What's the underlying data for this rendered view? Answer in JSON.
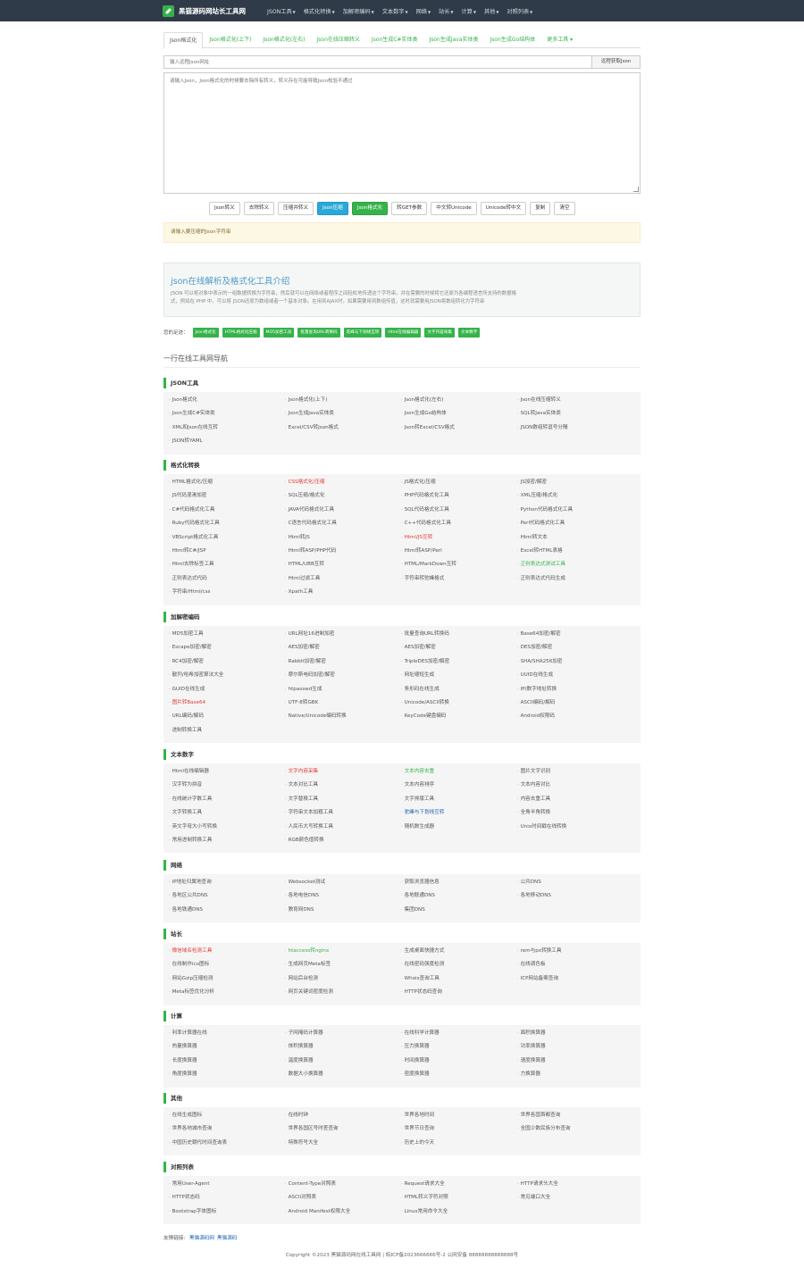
{
  "navbar": {
    "brand": "黑猫源码网站长工具网",
    "menu": [
      "JSON工具",
      "格式化转换",
      "加解密编码",
      "文本数字",
      "网络",
      "站长",
      "计算",
      "其他",
      "对照列表"
    ]
  },
  "tabs": [
    "Json格式化",
    "Json格式化(上下)",
    "Json格式化(左右)",
    "Json在线压缩转义",
    "Json生成C#实体类",
    "Json生成Java实体类",
    "Json生成Go结构体",
    "更多工具"
  ],
  "url_input": {
    "placeholder": "输入远程Json网址",
    "button": "远程获取Json"
  },
  "json_area": {
    "placeholder": "请输入Json，Json格式化的时候要去除所有转义，转义存在可能导致Json校验不通过"
  },
  "actions": [
    {
      "label": "Json转义",
      "style": "default"
    },
    {
      "label": "去除转义",
      "style": "default"
    },
    {
      "label": "压缩并转义",
      "style": "default"
    },
    {
      "label": "Json压缩",
      "style": "blue"
    },
    {
      "label": "Json格式化",
      "style": "green"
    },
    {
      "label": "转GET参数",
      "style": "default"
    },
    {
      "label": "中文转Unicode",
      "style": "default"
    },
    {
      "label": "Unicode转中文",
      "style": "default"
    },
    {
      "label": "复制",
      "style": "default"
    },
    {
      "label": "清空",
      "style": "default"
    }
  ],
  "alert": "请输入要压缩的Json字符串",
  "intro": {
    "title": "json在线解析及格式化工具介绍",
    "text1": "JSON 可以将对象中表示的一组数据转换为字符串，然后就可以在网络或者程序之间轻松地传递这个字符串，并在需要的时候将它还原为各编程语言所支持的数据格",
    "text2": "式，例如在 PHP 中，可以将 JSON还原为数组或者一个基本对象。在用到AJAX时，如果需要用到数组传值，这时就需要用JSON将数组转化为字符串"
  },
  "related": {
    "label": "您的足迹：",
    "tags": [
      "Json格式化",
      "HTML格式化压缩",
      "MD5加密工具",
      "批量查询URL转换码",
      "驼峰与下划线互转",
      "Html在线编辑器",
      "文字内容采集",
      "文本数字"
    ]
  },
  "tools_heading": "一行在线工具网导航",
  "categories": [
    {
      "title": "JSON工具",
      "items": [
        {
          "t": "Json格式化"
        },
        {
          "t": "Json格式化(上下)"
        },
        {
          "t": "Json格式化(左右)"
        },
        {
          "t": "Json在线压缩转义"
        },
        {
          "t": "Json生成C#实体类"
        },
        {
          "t": "Json生成Java实体类"
        },
        {
          "t": "Json生成Go结构体"
        },
        {
          "t": "SQL转Java实体类"
        },
        {
          "t": "XML和Json在线互转"
        },
        {
          "t": "Excel/CSV转Json格式"
        },
        {
          "t": "Json转Excel/CSV格式"
        },
        {
          "t": "JSON数组转逗号分隔"
        },
        {
          "t": "JSON转YAML"
        }
      ]
    },
    {
      "title": "格式化转换",
      "items": [
        {
          "t": "HTML格式化/压缩"
        },
        {
          "t": "CSS格式化/压缩",
          "c": "red"
        },
        {
          "t": "JS格式化/压缩"
        },
        {
          "t": "JS加密/解密"
        },
        {
          "t": "JS代码混淆加密"
        },
        {
          "t": "SQL压缩/格式化"
        },
        {
          "t": "PHP代码格式化工具"
        },
        {
          "t": "XML压缩/格式化"
        },
        {
          "t": "C#代码格式化工具"
        },
        {
          "t": "JAVA代码格式化工具"
        },
        {
          "t": "SQL代码格式化工具"
        },
        {
          "t": "Python代码格式化工具"
        },
        {
          "t": "Ruby代码格式化工具"
        },
        {
          "t": "C语言代码格式化工具"
        },
        {
          "t": "C++代码格式化工具"
        },
        {
          "t": "Perl代码格式化工具"
        },
        {
          "t": "VBScript格式化工具"
        },
        {
          "t": "Html转JS"
        },
        {
          "t": "Html/JS互转",
          "c": "red"
        },
        {
          "t": "Html转文本"
        },
        {
          "t": "Html转C#/JSP"
        },
        {
          "t": "Html转ASP/PHP代码"
        },
        {
          "t": "Html转ASP/Perl"
        },
        {
          "t": "Excel转HTML表格"
        },
        {
          "t": "Html去除标签工具"
        },
        {
          "t": "HTML/UBB互转"
        },
        {
          "t": "HTML/MarkDown互转"
        },
        {
          "t": "正则表达式测试工具",
          "c": "green"
        },
        {
          "t": "正则表达式代码"
        },
        {
          "t": "Html过滤工具"
        },
        {
          "t": "字符串转驼峰格式"
        },
        {
          "t": "正则表达式代码生成"
        },
        {
          "t": "字符串/Html/css"
        },
        {
          "t": "Xpath工具"
        }
      ]
    },
    {
      "title": "加解密编码",
      "items": [
        {
          "t": "MD5加密工具"
        },
        {
          "t": "URL网址16进制加密"
        },
        {
          "t": "批量查询URL转换码"
        },
        {
          "t": "Base64加密/解密"
        },
        {
          "t": "Escape加密/解密"
        },
        {
          "t": "AES加密/解密"
        },
        {
          "t": "AES加密/解密"
        },
        {
          "t": "DES加密/解密"
        },
        {
          "t": "RC4加密/解密"
        },
        {
          "t": "Rabbit加密/解密"
        },
        {
          "t": "TripleDES加密/解密"
        },
        {
          "t": "SHA/SHA256加密"
        },
        {
          "t": "散列/哈希加密算法大全"
        },
        {
          "t": "摩尔斯电码加密/解密"
        },
        {
          "t": "网址缩短生成"
        },
        {
          "t": "UUID在线生成"
        },
        {
          "t": "GUID在线生成"
        },
        {
          "t": "htpasswd生成"
        },
        {
          "t": "条形码在线生成"
        },
        {
          "t": "IP/数字地址转换"
        },
        {
          "t": "图片转Base64",
          "c": "red"
        },
        {
          "t": "UTF-8转GBK"
        },
        {
          "t": "Unicode/ASCII转换"
        },
        {
          "t": "ASCII编码/解码"
        },
        {
          "t": "URL编码/解码"
        },
        {
          "t": "Native/Unicode编码转换"
        },
        {
          "t": "KeyCode键盘编码"
        },
        {
          "t": "Android权限码"
        },
        {
          "t": "进制转换工具"
        }
      ]
    },
    {
      "title": "文本数字",
      "items": [
        {
          "t": "Html在线编辑器"
        },
        {
          "t": "文字内容采集",
          "c": "red"
        },
        {
          "t": "文本内容去重",
          "c": "green"
        },
        {
          "t": "图片文字识别"
        },
        {
          "t": "汉字转为拼音"
        },
        {
          "t": "文本对比工具"
        },
        {
          "t": "文本内容排序"
        },
        {
          "t": "文本内容对比"
        },
        {
          "t": "在线统计字数工具"
        },
        {
          "t": "文字替换工具"
        },
        {
          "t": "文字排版工具"
        },
        {
          "t": "内容去重工具"
        },
        {
          "t": "文字转换工具"
        },
        {
          "t": "字符串文本加粗工具"
        },
        {
          "t": "驼峰与下划线互转",
          "c": "blue"
        },
        {
          "t": "全角半角转换"
        },
        {
          "t": "英文字母大小写转换"
        },
        {
          "t": "人民币大写转换工具"
        },
        {
          "t": "随机数生成器"
        },
        {
          "t": "Unix时间戳在线转换"
        },
        {
          "t": "常用进制转换工具"
        },
        {
          "t": "RGB颜色值转换"
        }
      ]
    },
    {
      "title": "网络",
      "items": [
        {
          "t": "IP地址归属地查询"
        },
        {
          "t": "Websocket测试"
        },
        {
          "t": "获取浏览器信息"
        },
        {
          "t": "公共DNS"
        },
        {
          "t": "各地区公共DNS"
        },
        {
          "t": "各地电信DNS"
        },
        {
          "t": "各地联通DNS"
        },
        {
          "t": "各地移动DNS"
        },
        {
          "t": "各地铁通DNS"
        },
        {
          "t": "教育网DNS"
        },
        {
          "t": "集团DNS"
        }
      ]
    },
    {
      "title": "站长",
      "items": [
        {
          "t": "微信域名检测工具",
          "c": "red"
        },
        {
          "t": "htaccess转nginx",
          "c": "green"
        },
        {
          "t": "生成桌面快捷方式"
        },
        {
          "t": "rem与px转换工具"
        },
        {
          "t": "在线制作ico图标"
        },
        {
          "t": "生成网页Meta标签"
        },
        {
          "t": "在线密码强度检测"
        },
        {
          "t": "在线调色板"
        },
        {
          "t": "网站Gzip压缩检测"
        },
        {
          "t": "网站后台检测"
        },
        {
          "t": "Whois查询工具"
        },
        {
          "t": "ICP网站备案查询"
        },
        {
          "t": "Meta标签优化分析"
        },
        {
          "t": "网页关键词密度检测"
        },
        {
          "t": "HTTP状态码查询"
        }
      ]
    },
    {
      "title": "计算",
      "items": [
        {
          "t": "利率计算器在线"
        },
        {
          "t": "子网掩码计算器"
        },
        {
          "t": "在线科学计算器"
        },
        {
          "t": "面积换算器"
        },
        {
          "t": "热量换算器"
        },
        {
          "t": "体积换算器"
        },
        {
          "t": "压力换算器"
        },
        {
          "t": "功率换算器"
        },
        {
          "t": "长度换算器"
        },
        {
          "t": "温度换算器"
        },
        {
          "t": "时间换算器"
        },
        {
          "t": "速度换算器"
        },
        {
          "t": "角度换算器"
        },
        {
          "t": "数据大小换算器"
        },
        {
          "t": "密度换算器"
        },
        {
          "t": "力换算器"
        }
      ]
    },
    {
      "title": "其他",
      "items": [
        {
          "t": "在线生成图标"
        },
        {
          "t": "在线时钟"
        },
        {
          "t": "世界各地时间"
        },
        {
          "t": "世界各国首都查询"
        },
        {
          "t": "世界各地城市查询"
        },
        {
          "t": "世界各国区号时差查询"
        },
        {
          "t": "世界节日查询"
        },
        {
          "t": "全国少数民族分布查询"
        },
        {
          "t": "中国历史朝代时间查询表"
        },
        {
          "t": "特殊符号大全"
        },
        {
          "t": "历史上的今天"
        }
      ]
    },
    {
      "title": "对照列表",
      "items": [
        {
          "t": "常用User-Agent"
        },
        {
          "t": "Content-Type对照表"
        },
        {
          "t": "Request请求大全"
        },
        {
          "t": "HTTP请求头大全"
        },
        {
          "t": "HTTP状态码"
        },
        {
          "t": "ASCII对照表"
        },
        {
          "t": "HTML转义字符对照"
        },
        {
          "t": "常见端口大全"
        },
        {
          "t": "Bootstrap字体图标"
        },
        {
          "t": "Android Manifest权限大全"
        },
        {
          "t": "Linux常用命令大全"
        }
      ]
    }
  ],
  "footer": {
    "links_label": "友情链接:",
    "links": [
      "黑猫源码网",
      "黑猫源码"
    ],
    "copyright": "Copyright ©2023 黑猫源码网在线工具网  |  皖ICP备2023666666号-2  公网安备 88888888888888号"
  },
  "colors": {
    "navbar": "#2f3b48",
    "accent_green": "#35b34a",
    "accent_blue": "#2aa8d8",
    "link_red": "#e03c31"
  }
}
